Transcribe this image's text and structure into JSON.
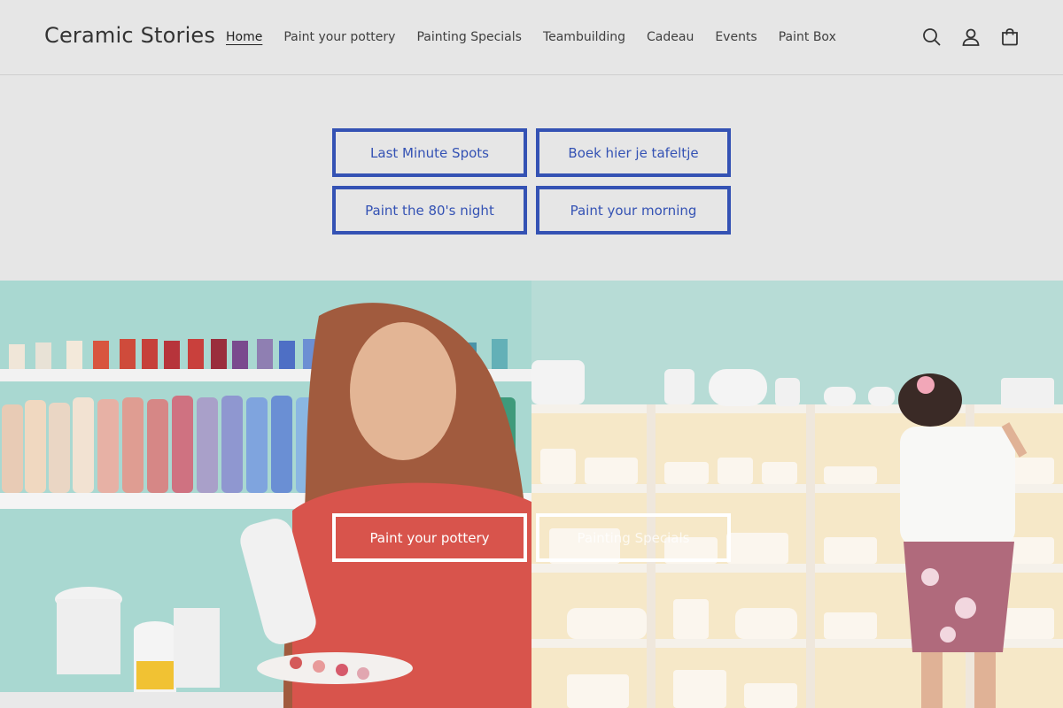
{
  "header": {
    "logo": "Ceramic Stories",
    "nav": [
      {
        "label": "Home",
        "active": true
      },
      {
        "label": "Paint your pottery",
        "active": false
      },
      {
        "label": "Painting Specials",
        "active": false
      },
      {
        "label": "Teambuilding",
        "active": false
      },
      {
        "label": "Cadeau",
        "active": false
      },
      {
        "label": "Events",
        "active": false
      },
      {
        "label": "Paint Box",
        "active": false
      }
    ],
    "icons": [
      "search-icon",
      "account-icon",
      "cart-icon"
    ]
  },
  "buttons": [
    {
      "label": "Last Minute Spots"
    },
    {
      "label": "Boek hier je tafeltje"
    },
    {
      "label": "Paint the 80's night"
    },
    {
      "label": "Paint your morning"
    }
  ],
  "banner": {
    "left_button": "Paint your pottery",
    "right_button": "Painting Specials"
  },
  "colors": {
    "accent": "#3452b4",
    "background": "#e6e6e6"
  }
}
